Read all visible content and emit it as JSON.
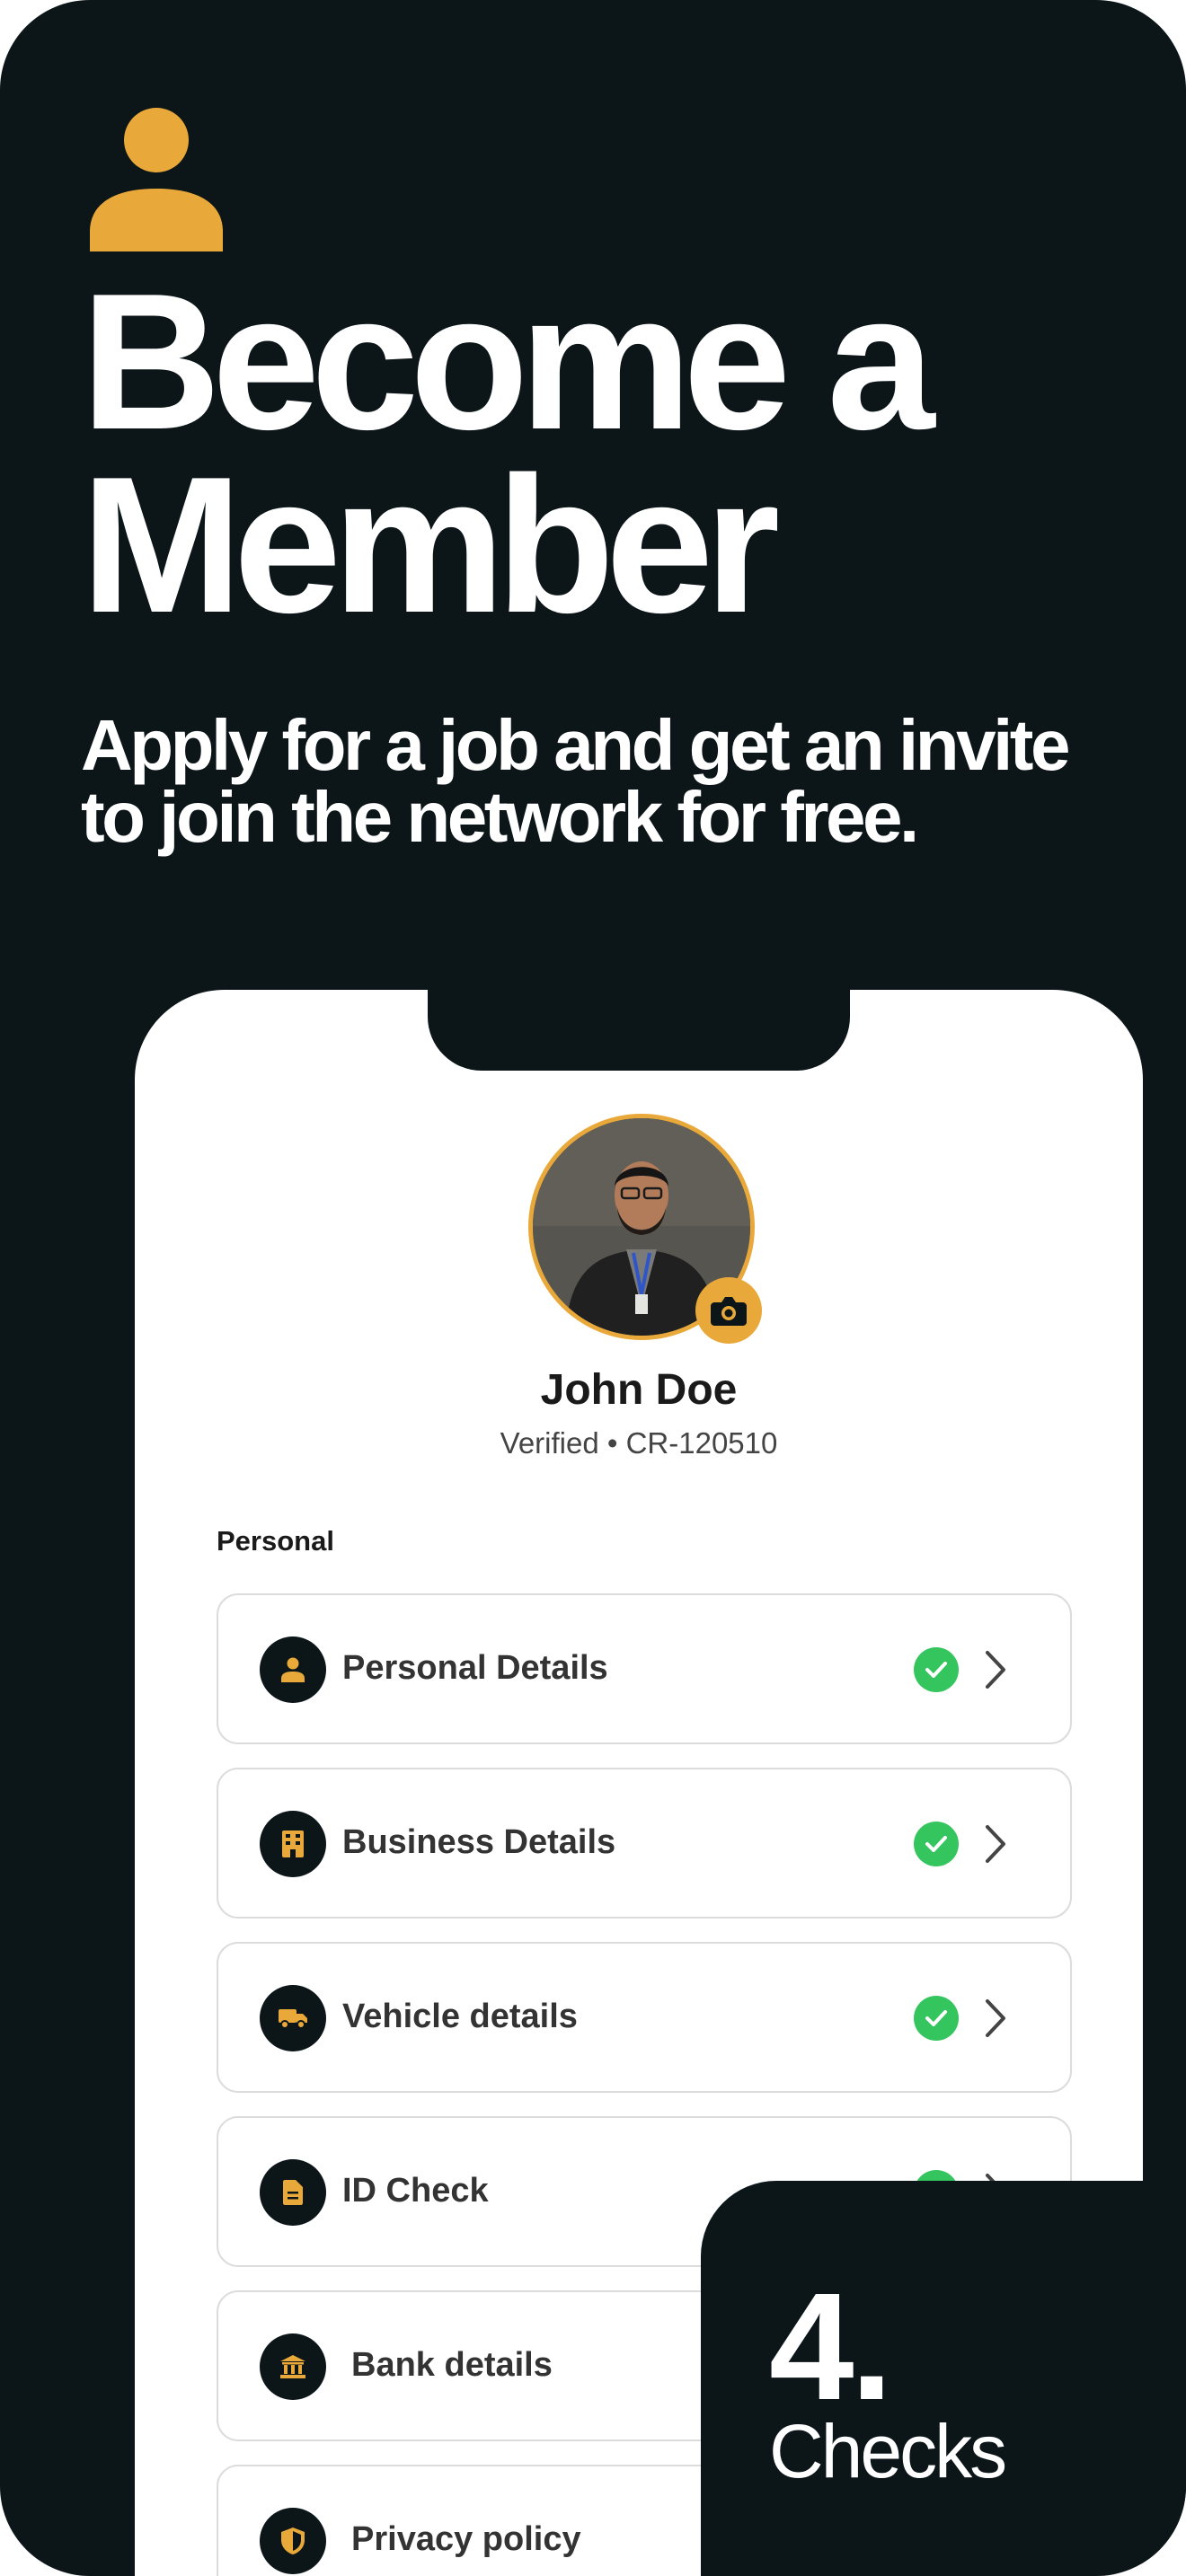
{
  "hero": {
    "icon": "person-icon",
    "headline_line1": "Become a",
    "headline_line2": "Member",
    "subhead_line1": "Apply for a job and get an invite",
    "subhead_line2": "to join the network for free."
  },
  "profile": {
    "avatar": "profile-photo",
    "camera_icon": "camera-icon",
    "name": "John Doe",
    "meta": "Verified • CR-120510"
  },
  "section": {
    "label": "Personal"
  },
  "rows": [
    {
      "label": "Personal Details",
      "icon": "person-icon",
      "status": "complete"
    },
    {
      "label": "Business Details",
      "icon": "building-icon",
      "status": "complete"
    },
    {
      "label": "Vehicle details",
      "icon": "truck-icon",
      "status": "complete"
    },
    {
      "label": "ID Check",
      "icon": "document-icon",
      "status": "complete"
    },
    {
      "label": "Bank details",
      "icon": "bank-icon",
      "status": ""
    },
    {
      "label": "Privacy policy",
      "icon": "shield-icon",
      "status": ""
    }
  ],
  "badge": {
    "number": "4.",
    "text": "Checks"
  },
  "colors": {
    "background": "#0c1517",
    "accent": "#e9a93a",
    "success": "#34c55e",
    "card": "#ffffff"
  }
}
